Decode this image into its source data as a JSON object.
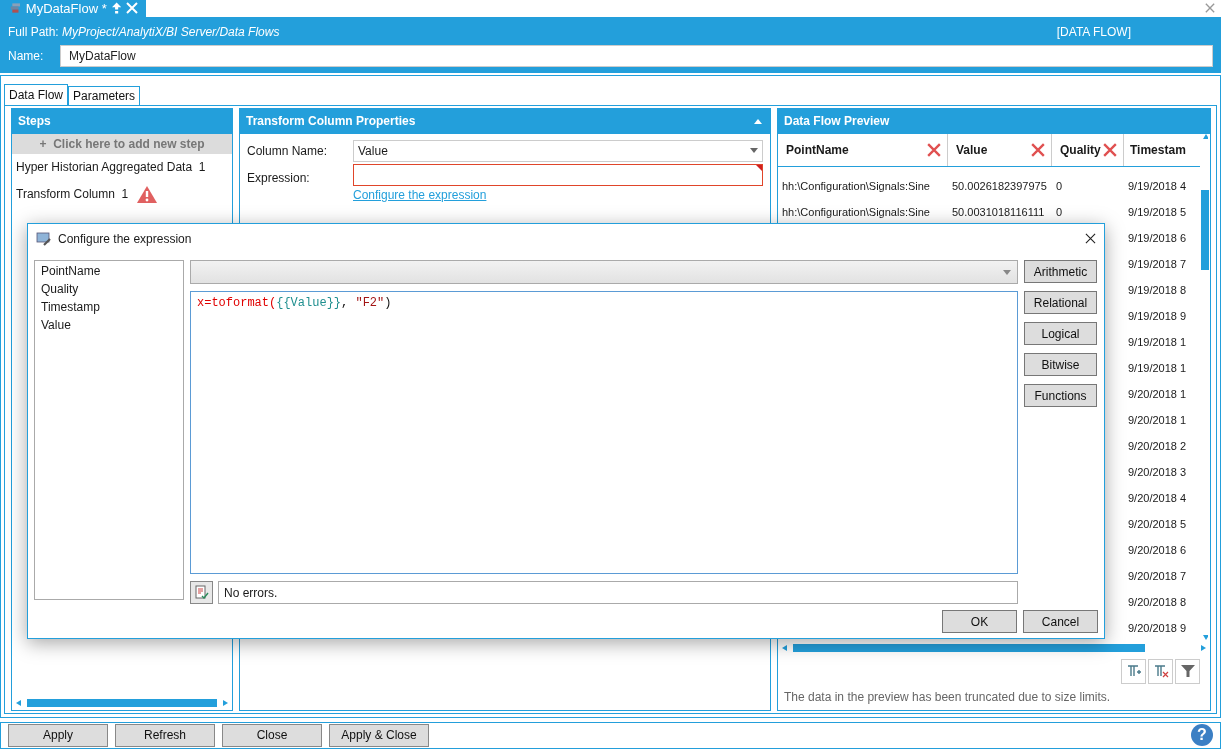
{
  "document_tab": {
    "title": "MyDataFlow *",
    "selected": true
  },
  "header": {
    "full_path_label": "Full Path:",
    "full_path": "MyProject/AnalytiX/BI Server/Data Flows",
    "type_label": "[DATA FLOW]",
    "name_label": "Name:",
    "name_value": "MyDataFlow"
  },
  "tabs": [
    {
      "label": "Data Flow",
      "selected": true
    },
    {
      "label": "Parameters",
      "selected": false
    }
  ],
  "steps": {
    "title": "Steps",
    "add_label": "+  Click here to add new step",
    "items": [
      {
        "label": "Hyper Historian Aggregated Data",
        "count": "1",
        "warning": false
      },
      {
        "label": "Transform Column",
        "count": "1",
        "warning": true
      }
    ]
  },
  "properties": {
    "title": "Transform Column Properties",
    "expanded": true,
    "column_name_label": "Column Name:",
    "column_name_value": "Value",
    "expression_label": "Expression:",
    "expression_invalid": true,
    "link": "Configure the expression"
  },
  "preview": {
    "title": "Data Flow Preview",
    "columns": [
      {
        "label": "PointName",
        "removable": true
      },
      {
        "label": "Value",
        "removable": true
      },
      {
        "label": "Quality",
        "removable": true
      },
      {
        "label": "Timestam",
        "removable": false
      }
    ],
    "rows": [
      {
        "point_name": "hh:\\Configuration\\Signals:Sine",
        "value": "50.0026182397975",
        "quality": "0",
        "timestamp": "9/19/2018 4"
      },
      {
        "point_name": "hh:\\Configuration\\Signals:Sine",
        "value": "50.0031018116111",
        "quality": "0",
        "timestamp": "9/19/2018 5"
      },
      {
        "timestamp": "9/19/2018 6"
      },
      {
        "timestamp": "9/19/2018 7"
      },
      {
        "timestamp": "9/19/2018 8"
      },
      {
        "timestamp": "9/19/2018 9"
      },
      {
        "timestamp": "9/19/2018 1"
      },
      {
        "timestamp": "9/19/2018 1"
      },
      {
        "timestamp": "9/20/2018 1"
      },
      {
        "timestamp": "9/20/2018 1"
      },
      {
        "timestamp": "9/20/2018 2"
      },
      {
        "timestamp": "9/20/2018 3"
      },
      {
        "timestamp": "9/20/2018 4"
      },
      {
        "timestamp": "9/20/2018 5"
      },
      {
        "timestamp": "9/20/2018 6"
      },
      {
        "timestamp": "9/20/2018 7"
      },
      {
        "timestamp": "9/20/2018 8"
      },
      {
        "timestamp": "9/20/2018 9"
      }
    ],
    "note": "The data in the preview has been truncated due to size limits."
  },
  "dialog": {
    "title": "Configure the expression",
    "fields": [
      "PointName",
      "Quality",
      "Timestamp",
      "Value"
    ],
    "expression": [
      {
        "text": "x=toformat(",
        "kind": "function"
      },
      {
        "text": "{{Value}}",
        "kind": "column"
      },
      {
        "text": ", ",
        "kind": "plain"
      },
      {
        "text": "\"F2\"",
        "kind": "string"
      },
      {
        "text": ")",
        "kind": "plain"
      }
    ],
    "status": "No errors.",
    "operator_buttons": [
      "Arithmetic",
      "Relational",
      "Logical",
      "Bitwise",
      "Functions"
    ],
    "buttons": [
      "OK",
      "Cancel"
    ]
  },
  "footer_buttons": [
    "Apply",
    "Refresh",
    "Close",
    "Apply & Close"
  ],
  "help_glyph": "?"
}
